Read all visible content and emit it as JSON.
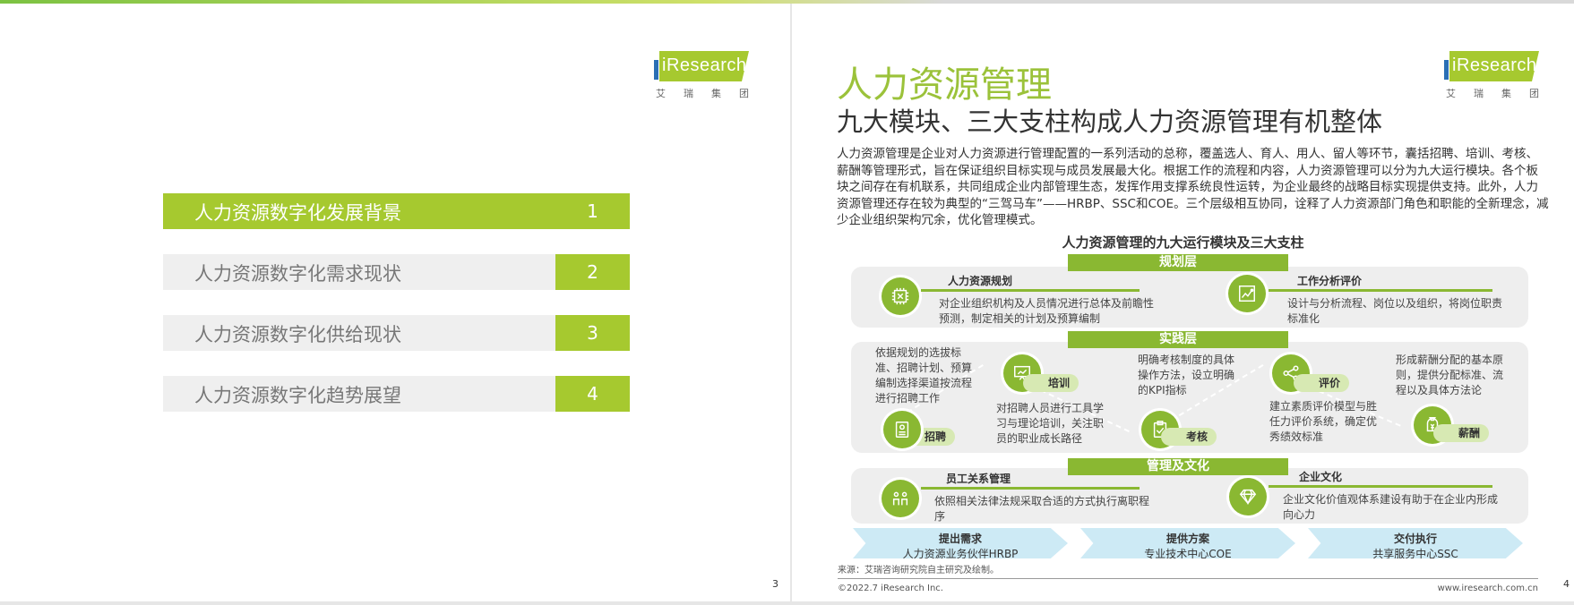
{
  "brand": {
    "accent": "#a6c92f",
    "dark_green": "#8ab832",
    "logo_word": "iResearch",
    "logo_cn": "艾瑞集团"
  },
  "left_page": {
    "page_number": "3",
    "toc": [
      {
        "label": "人力资源数字化发展背景",
        "num": "1",
        "active": true
      },
      {
        "label": "人力资源数字化需求现状",
        "num": "2",
        "active": false
      },
      {
        "label": "人力资源数字化供给现状",
        "num": "3",
        "active": false
      },
      {
        "label": "人力资源数字化趋势展望",
        "num": "4",
        "active": false
      }
    ]
  },
  "right_page": {
    "page_number": "4",
    "title": "人力资源管理",
    "subtitle": "九大模块、三大支柱构成人力资源管理有机整体",
    "body": "人力资源管理是企业对人力资源进行管理配置的一系列活动的总称，覆盖选人、育人、用人、留人等环节，囊括招聘、培训、考核、薪酬等管理形式，旨在保证组织目标实现与成员发展最大化。根据工作的流程和内容，人力资源管理可以分为九大运行模块。各个板块之间存在有机联系，共同组成企业内部管理生态，发挥作用支撑系统良性运转，为企业最终的战略目标实现提供支持。此外，人力资源管理还存在较为典型的“三驾马车”——HRBP、SSC和COE。三个层级相互协同，诠释了人力资源部门角色和职能的全新理念，减少企业组织架构冗余，优化管理模式。",
    "diagram": {
      "title": "人力资源管理的九大运行模块及三大支柱",
      "layers": {
        "planning": "规划层",
        "practice": "实践层",
        "management": "管理及文化"
      },
      "planning": [
        {
          "name": "人力资源规划",
          "desc": "对企业组织机构及人员情况进行总体及前瞻性预测，制定相关的计划及预算编制",
          "icon": "chip-icon"
        },
        {
          "name": "工作分析评价",
          "desc": "设计与分析流程、岗位以及组织，将岗位职责标准化",
          "icon": "line-chart-icon"
        }
      ],
      "practice": {
        "recruit": {
          "name": "招聘",
          "desc": "依据规划的选拔标准、招聘计划、预算编制选择渠道按流程进行招聘工作",
          "icon": "id-card-icon"
        },
        "training": {
          "name": "培训",
          "desc": "对招聘人员进行工具学习与理论培训，关注职员的职业成长路径",
          "icon": "presentation-icon"
        },
        "assess": {
          "name": "考核",
          "desc": "明确考核制度的具体操作方法，设立明确的KPI指标",
          "icon": "clipboard-icon"
        },
        "evaluate": {
          "name": "评价",
          "desc": "建立素质评价模型与胜任力评价系统，确定优秀绩效标准",
          "icon": "share-icon"
        },
        "salary": {
          "name": "薪酬",
          "desc": "形成薪酬分配的基本原则，提供分配标准、流程以及具体方法论",
          "icon": "money-bag-icon"
        }
      },
      "management": [
        {
          "name": "员工关系管理",
          "desc": "依照相关法律法规采取合适的方式执行离职程序",
          "icon": "people-icon"
        },
        {
          "name": "企业文化",
          "desc": "企业文化价值观体系建设有助于在企业内形成向心力",
          "icon": "diamond-icon"
        }
      ],
      "pillars": [
        {
          "t1": "提出需求",
          "t2": "人力资源业务伙伴HRBP"
        },
        {
          "t1": "提供方案",
          "t2": "专业技术中心COE"
        },
        {
          "t1": "交付执行",
          "t2": "共享服务中心SSC"
        }
      ]
    },
    "source": "来源：艾瑞咨询研究院自主研究及绘制。",
    "footer_left": "©2022.7 iResearch Inc.",
    "footer_right": "www.iresearch.com.cn"
  }
}
